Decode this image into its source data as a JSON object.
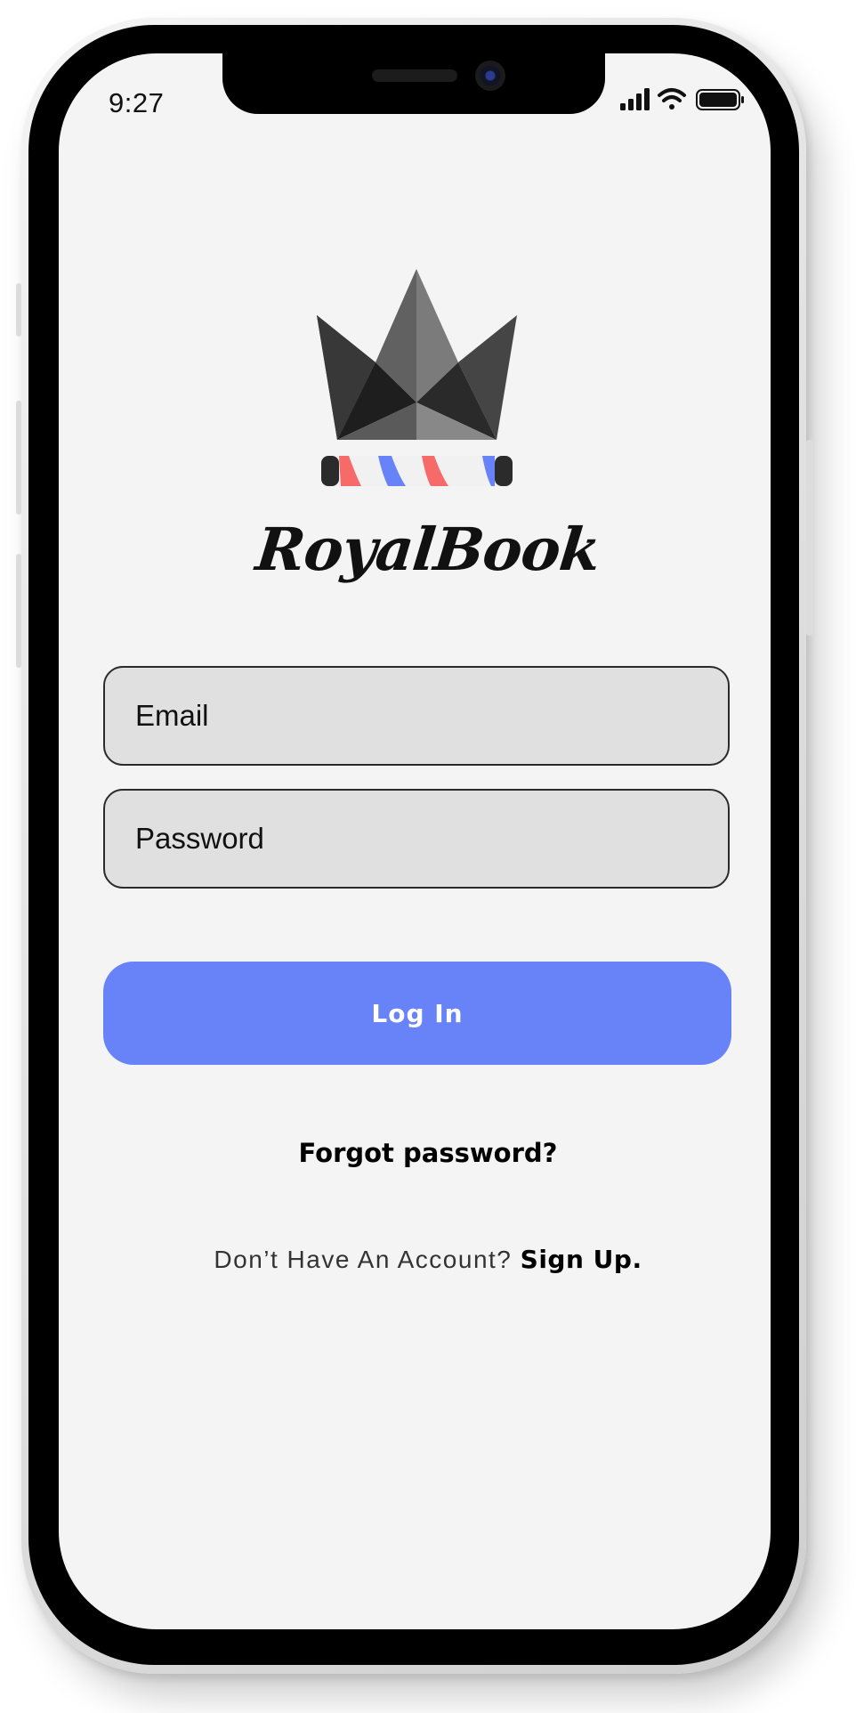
{
  "status_bar": {
    "time": "9:27",
    "icons": [
      "signal-icon",
      "wifi-icon",
      "battery-icon"
    ]
  },
  "brand": {
    "name": "RoyalBook",
    "logo_icon": "crown-logo-icon"
  },
  "form": {
    "email_placeholder": "Email",
    "password_placeholder": "Password",
    "login_label": "Log In",
    "forgot_label": "Forgot password?"
  },
  "signup": {
    "prompt": "Don’t Have An Account?",
    "link_label": "Sign Up."
  },
  "colors": {
    "accent": "#6882f8",
    "stripe_red": "#f66a6a",
    "stripe_blue": "#6882f8",
    "screen_background": "#f4f4f4",
    "field_background": "#e0e0e0"
  }
}
